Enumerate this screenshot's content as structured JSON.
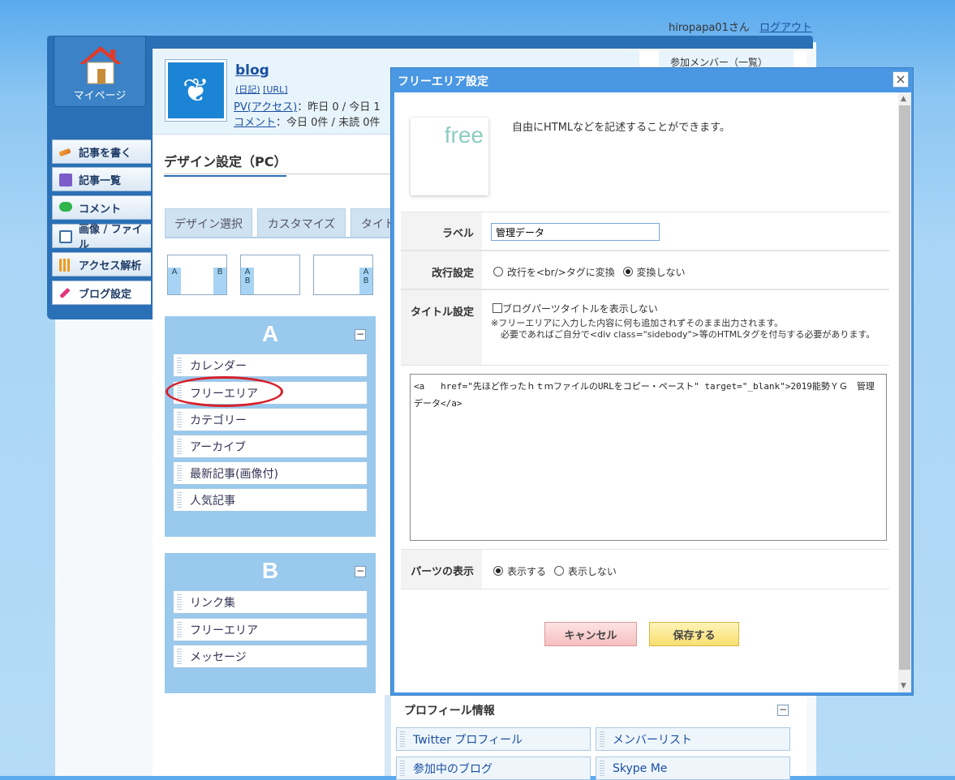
{
  "header": {
    "user": "hiropapa01さん",
    "logout": "ログアウト"
  },
  "nav": {
    "mypage": "マイページ",
    "items": [
      "記事を書く",
      "記事一覧",
      "コメント",
      "画像 / ファイル",
      "アクセス解析",
      "ブログ設定"
    ]
  },
  "blog": {
    "title": "blog",
    "diary_link": "(日記)",
    "url_link": "[URL]",
    "pv_label": "PV(アクセス)",
    "pv_text": "：昨日 0 / 今日 1",
    "comment_label": "コメント",
    "comment_text": "：今日 0件 / 未読 0件"
  },
  "members_link": "参加メンバー（一覧）",
  "page_title": "デザイン設定（PC）",
  "tabs": [
    "デザイン選択",
    "カスタマイズ",
    "タイト"
  ],
  "layout_letters": {
    "a": "A",
    "b": "B"
  },
  "box_a": {
    "title": "A",
    "items": [
      "カレンダー",
      "フリーエリア",
      "カテゴリー",
      "アーカイブ",
      "最新記事(画像付)",
      "人気記事"
    ]
  },
  "box_b": {
    "title": "B",
    "items": [
      "リンク集",
      "フリーエリア",
      "メッセージ"
    ]
  },
  "minus": "−",
  "dialog": {
    "title": "フリーエリア設定",
    "close": "×",
    "icon_text": "free",
    "description": "自由にHTMLなどを記述することができます。",
    "label_label": "ラベル",
    "label_value": "管理データ",
    "newline_label": "改行設定",
    "newline_opt1": "改行を<br/>タグに変換",
    "newline_opt2": "変換しない",
    "title_label": "タイトル設定",
    "title_checkbox": "ブログパーツタイトルを表示しない",
    "title_note1": "※フリーエリアに入力した内容に何も追加されずそのまま出力されます。",
    "title_note2": "必要であればご自分で<div class=\"sidebody\">等のHTMLタグを付与する必要があります。",
    "code": "<a   href=\"先ほど作ったｈｔｍファイルのURLをコピー・ペースト\" target=\"_blank\">2019能勢ＹＧ　管理データ</a>",
    "display_label": "パーツの表示",
    "display_opt1": "表示する",
    "display_opt2": "表示しない",
    "cancel": "キャンセル",
    "save": "保存する"
  },
  "profile": {
    "title": "プロフィール情報",
    "items": [
      "Twitter プロフィール",
      "メンバーリスト",
      "参加中のブログ",
      "Skype Me"
    ]
  },
  "colors": {
    "accent": "#4a97e3",
    "nav": "#2a70b6",
    "sidebox": "#99c9ed",
    "highlight": "#d8202a"
  }
}
